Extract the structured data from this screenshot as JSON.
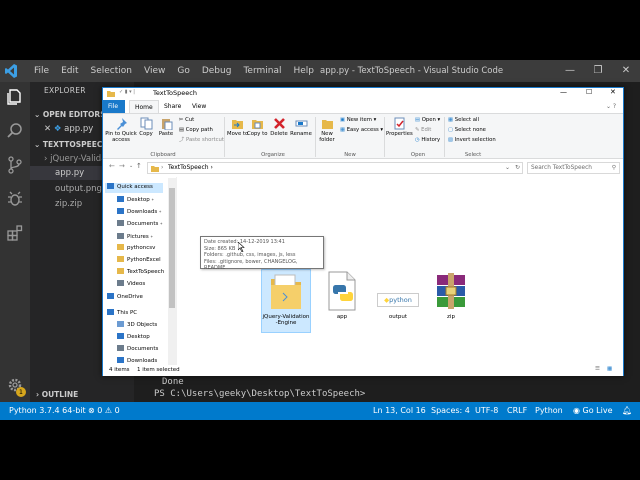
{
  "vscode": {
    "menu": [
      "File",
      "Edit",
      "Selection",
      "View",
      "Go",
      "Debug",
      "Terminal",
      "Help"
    ],
    "window_title": "app.py - TextToSpeech - Visual Studio Code",
    "controls": {
      "minimize": "—",
      "restore": "❐",
      "close": "✕"
    },
    "sidebar": {
      "header": "EXPLORER",
      "open_editors_label": "OPEN EDITORS",
      "open_editor_file": "app.py",
      "project_label": "TEXTTOSPEECH",
      "files": [
        "jQuery-Valida",
        "app.py",
        "output.png",
        "zip.zip"
      ],
      "outline_label": "OUTLINE"
    },
    "terminal": {
      "line1": "Done",
      "line2": "PS C:\\Users\\geeky\\Desktop\\TextToSpeech>"
    },
    "statusbar": {
      "python": "Python 3.7.4 64-bit",
      "problems": "⊗ 0  ⚠ 0",
      "position": "Ln 13, Col 16",
      "spaces": "Spaces: 4",
      "encoding": "UTF-8",
      "eol": "CRLF",
      "language": "Python",
      "golive": "◉ Go Live"
    },
    "badge": "1"
  },
  "explorer": {
    "title": "TextToSpeech",
    "tabs": [
      "File",
      "Home",
      "Share",
      "View"
    ],
    "ribbon": {
      "pin": "Pin to Quick access",
      "copy": "Copy",
      "paste": "Paste",
      "cut": "Cut",
      "copy_path": "Copy path",
      "paste_shortcut": "Paste shortcut",
      "move_to": "Move to",
      "copy_to": "Copy to",
      "delete": "Delete",
      "rename": "Rename",
      "new_folder": "New folder",
      "new_item": "New item",
      "easy_access": "Easy access",
      "properties": "Properties",
      "open": "Open",
      "edit": "Edit",
      "history": "History",
      "select_all": "Select all",
      "select_none": "Select none",
      "invert_selection": "Invert selection",
      "groups": {
        "clipboard": "Clipboard",
        "organize": "Organize",
        "new": "New",
        "open": "Open",
        "select": "Select"
      }
    },
    "address": "TextToSpeech",
    "search_placeholder": "Search TextToSpeech",
    "nav": [
      {
        "label": "Quick access",
        "color": "#2b74c7"
      },
      {
        "label": "Desktop",
        "color": "#2b74c7"
      },
      {
        "label": "Downloads",
        "color": "#2b74c7"
      },
      {
        "label": "Documents",
        "color": "#6c7c8c"
      },
      {
        "label": "Pictures",
        "color": "#6c7c8c"
      },
      {
        "label": "pythoncsv",
        "color": "#e6b84a"
      },
      {
        "label": "PythonExcel",
        "color": "#e6b84a"
      },
      {
        "label": "TextToSpeech",
        "color": "#e6b84a"
      },
      {
        "label": "Videos",
        "color": "#6c7c8c"
      },
      {
        "label": "OneDrive",
        "color": "#2b74c7"
      },
      {
        "label": "This PC",
        "color": "#2b74c7"
      },
      {
        "label": "3D Objects",
        "color": "#6c9bd2"
      },
      {
        "label": "Desktop",
        "color": "#2b74c7"
      },
      {
        "label": "Documents",
        "color": "#6c7c8c"
      },
      {
        "label": "Downloads",
        "color": "#2b74c7"
      }
    ],
    "files": [
      {
        "label1": "jQuery-Validation",
        "label2": "-Engine"
      },
      {
        "label1": "app",
        "label2": ""
      },
      {
        "label1": "output",
        "label2": ""
      },
      {
        "label1": "zip",
        "label2": ""
      }
    ],
    "output_preview": "python",
    "tooltip": {
      "created": "Date created: 14-12-2019 13:41",
      "size": "Size: 865 KB",
      "folders": "Folders: .github, css, images, js, less",
      "files": "Files: .gitignore, bower, CHANGELOG, README"
    },
    "status": {
      "items": "4 items",
      "selected": "1 item selected"
    }
  }
}
